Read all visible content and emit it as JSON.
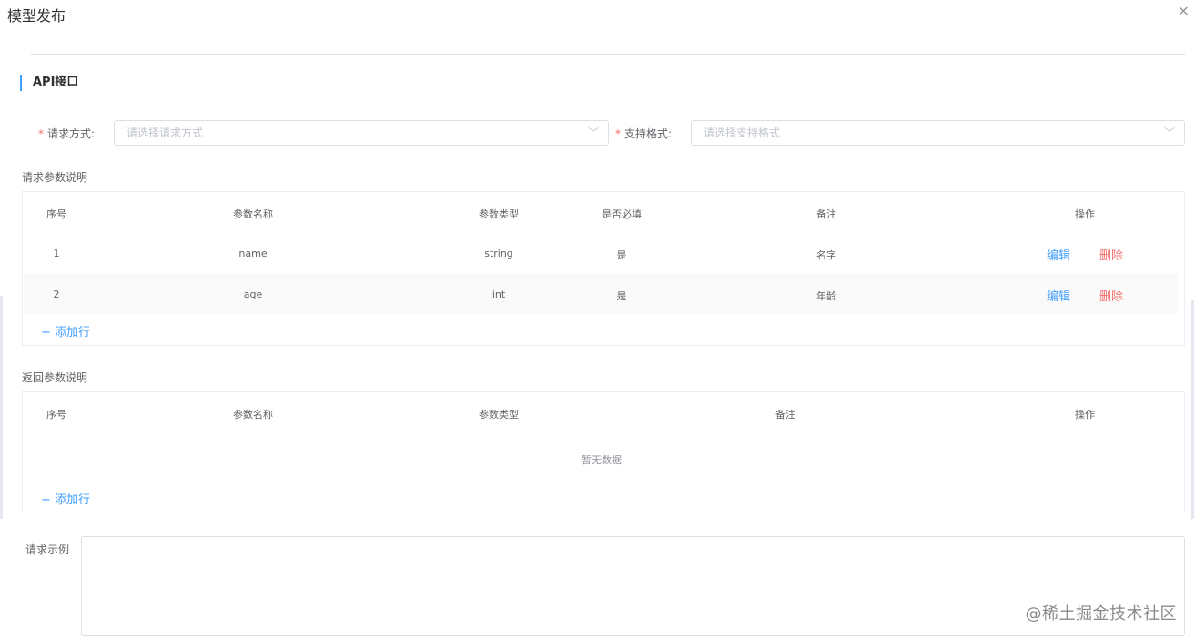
{
  "dialog": {
    "title": "模型发布",
    "close_glyph": "×"
  },
  "section": {
    "title": "API接口"
  },
  "form": {
    "method": {
      "label": "请求方式:",
      "placeholder": "请选择请求方式",
      "required": "*"
    },
    "format": {
      "label": "支持格式:",
      "placeholder": "请选择支持格式",
      "required": "*"
    },
    "arrow_glyph": "﹀"
  },
  "request_params": {
    "label": "请求参数说明",
    "headers": [
      "序号",
      "参数名称",
      "参数类型",
      "是否必填",
      "备注",
      "操作"
    ],
    "rows": [
      {
        "index": "1",
        "name": "name",
        "type": "string",
        "required": "是",
        "remark": "名字",
        "edit": "编辑",
        "delete": "删除"
      },
      {
        "index": "2",
        "name": "age",
        "type": "int",
        "required": "是",
        "remark": "年龄",
        "edit": "编辑",
        "delete": "删除"
      }
    ],
    "add_row": "+ 添加行"
  },
  "response_params": {
    "label": "返回参数说明",
    "headers": [
      "序号",
      "参数名称",
      "参数类型",
      "备注",
      "操作"
    ],
    "empty_text": "暂无数据",
    "add_row": "+ 添加行"
  },
  "request_example": {
    "label": "请求示例",
    "value": ""
  },
  "watermark": "@稀土掘金技术社区",
  "colors": {
    "primary": "#409eff",
    "danger": "#f56c6c",
    "border": "#dcdfe6"
  }
}
